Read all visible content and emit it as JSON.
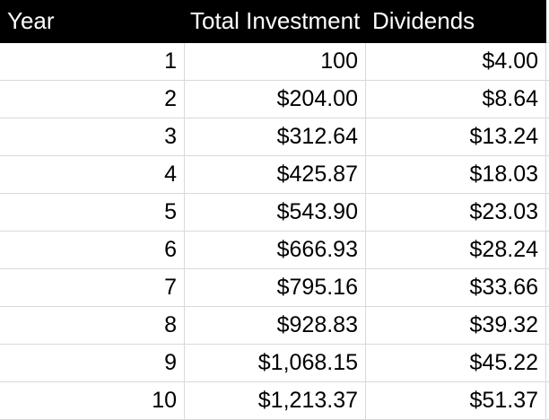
{
  "table": {
    "headers": [
      "Year",
      "Total Investment",
      "Dividends"
    ],
    "rows": [
      {
        "year": "1",
        "total": "100",
        "dividends": "$4.00"
      },
      {
        "year": "2",
        "total": "$204.00",
        "dividends": "$8.64"
      },
      {
        "year": "3",
        "total": "$312.64",
        "dividends": "$13.24"
      },
      {
        "year": "4",
        "total": "$425.87",
        "dividends": "$18.03"
      },
      {
        "year": "5",
        "total": "$543.90",
        "dividends": "$23.03"
      },
      {
        "year": "6",
        "total": "$666.93",
        "dividends": "$28.24"
      },
      {
        "year": "7",
        "total": "$795.16",
        "dividends": "$33.66"
      },
      {
        "year": "8",
        "total": "$928.83",
        "dividends": "$39.32"
      },
      {
        "year": "9",
        "total": "$1,068.15",
        "dividends": "$45.22"
      },
      {
        "year": "10",
        "total": "$1,213.37",
        "dividends": "$51.37"
      }
    ]
  },
  "colors": {
    "header_background": "#000000",
    "header_text": "#ffffff",
    "gridline": "#d9d9d9"
  }
}
